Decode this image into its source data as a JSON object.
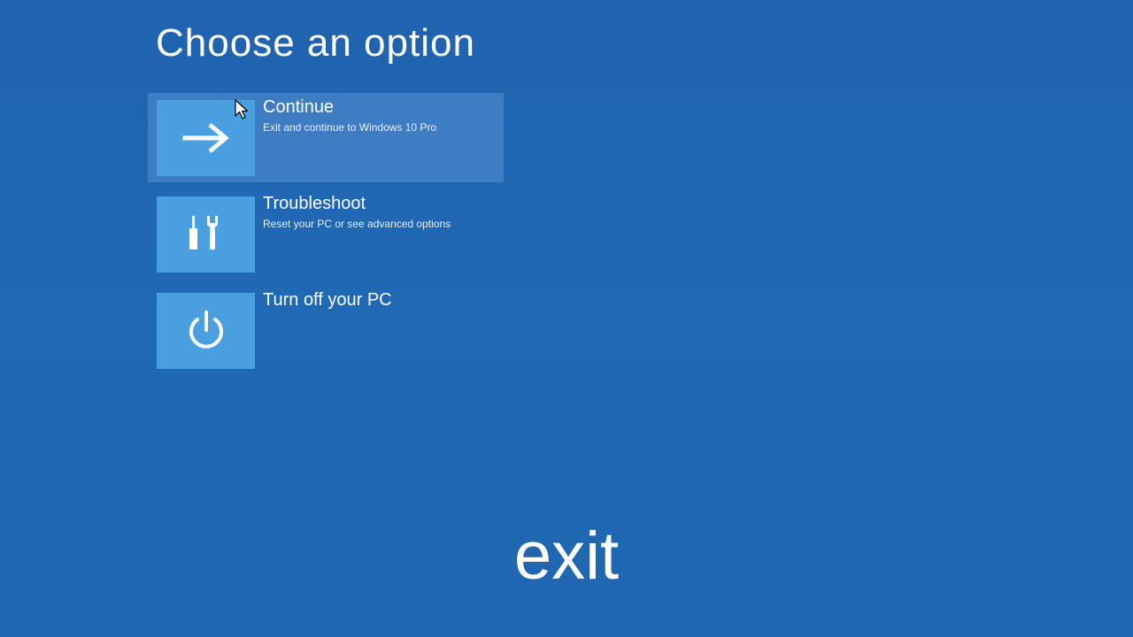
{
  "page": {
    "title": "Choose an option"
  },
  "options": [
    {
      "title": "Continue",
      "description": "Exit and continue to Windows 10 Pro",
      "icon": "arrow-right-icon",
      "selected": true
    },
    {
      "title": "Troubleshoot",
      "description": "Reset your PC or see advanced options",
      "icon": "tools-icon",
      "selected": false
    },
    {
      "title": "Turn off your PC",
      "description": "",
      "icon": "power-icon",
      "selected": false
    }
  ],
  "caption": {
    "text": "exit"
  },
  "colors": {
    "background": "#2166b2",
    "tile": "#4a9fe0",
    "selected_highlight": "#5b8fcf",
    "text": "#ffffff"
  }
}
